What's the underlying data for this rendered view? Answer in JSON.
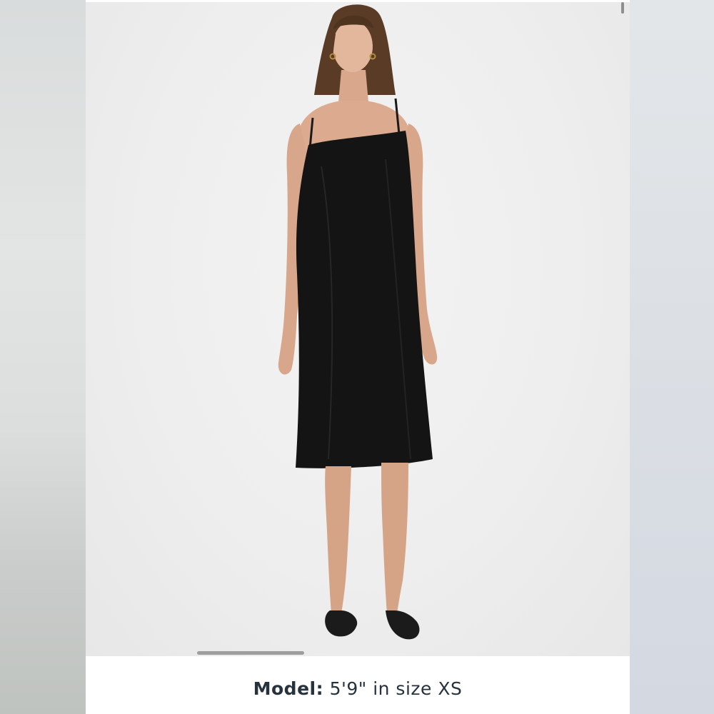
{
  "caption": {
    "label": "Model:",
    "value": "5'9\" in size XS"
  },
  "photo": {
    "subject": "model-wearing-black-slip-dress",
    "background_color": "#eeeeee",
    "dress_color": "#141414"
  },
  "carousel": {
    "indicator_color": "#9e9e9e"
  }
}
